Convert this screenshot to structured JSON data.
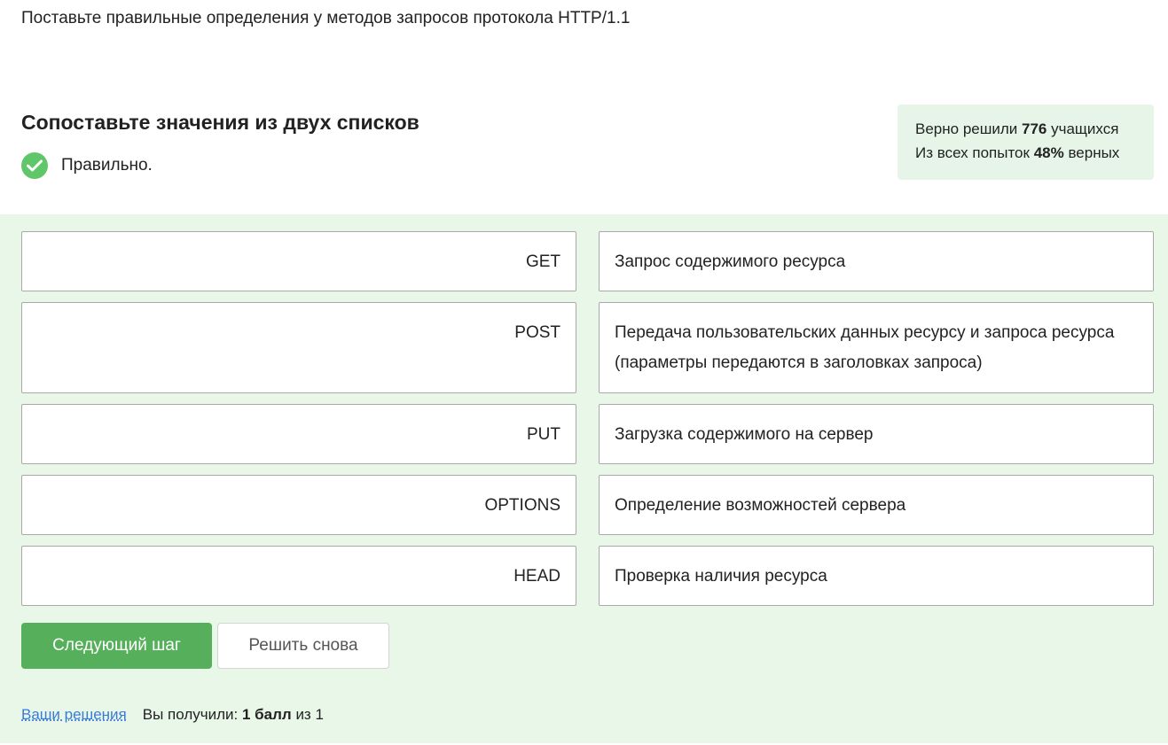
{
  "question": "Поставьте правильные определения у методов запросов протокола HTTP/1.1",
  "quiz": {
    "title": "Сопоставьте значения из двух списков",
    "status_label": "Правильно."
  },
  "stats": {
    "solved_prefix": "Верно решили",
    "solved_count": "776",
    "solved_suffix": "учащихся",
    "attempts_prefix": "Из всех попыток",
    "attempts_percent": "48%",
    "attempts_suffix": "верных"
  },
  "pairs": [
    {
      "method": "GET",
      "definition": "Запрос содержимого ресурса"
    },
    {
      "method": "POST",
      "definition": "Передача пользовательских данных ресурсу и запроса ресурса (параметры передаются в заголовках запроса)"
    },
    {
      "method": "PUT",
      "definition": "Загрузка содержимого на сервер"
    },
    {
      "method": "OPTIONS",
      "definition": "Определение возможностей сервера"
    },
    {
      "method": "HEAD",
      "definition": "Проверка наличия ресурса"
    }
  ],
  "buttons": {
    "next_label": "Следующий шаг",
    "retry_label": "Решить снова"
  },
  "footer": {
    "solutions_link": "Ваши решения",
    "score_prefix": "Вы получили:",
    "score_value": "1 балл",
    "score_suffix": "из 1"
  },
  "colors": {
    "accent_green": "#56b05b",
    "check_green": "#5fc76a",
    "panel_bg": "#e8f7e8",
    "stats_bg": "#e6f5e7",
    "link_blue": "#3a7bd5"
  }
}
